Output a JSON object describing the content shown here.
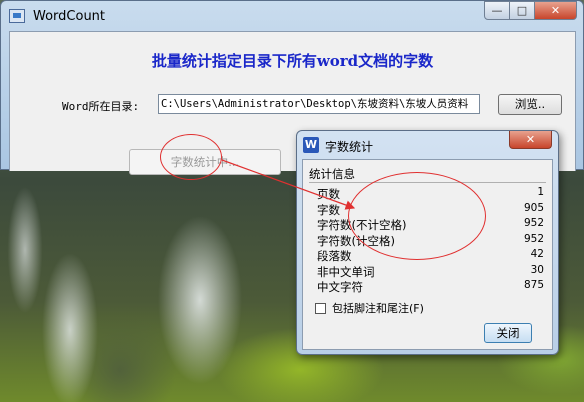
{
  "main_window": {
    "title": "WordCount",
    "buttons": {
      "minimize": "—",
      "maximize": "□",
      "close": "✕"
    },
    "headline": "批量统计指定目录下所有word文档的字数",
    "dir_label": "Word所在目录:",
    "dir_value": "C:\\Users\\Administrator\\Desktop\\东坡资料\\东坡人员资料",
    "browse_label": "浏览..",
    "count_label": "字数统计中..."
  },
  "dialog": {
    "icon_letter": "W",
    "title": "字数统计",
    "close_glyph": "✕",
    "group_label": "统计信息",
    "stats": [
      {
        "label": "页数",
        "value": "1"
      },
      {
        "label": "字数",
        "value": "905"
      },
      {
        "label": "字符数(不计空格)",
        "value": "952"
      },
      {
        "label": "字符数(计空格)",
        "value": "952"
      },
      {
        "label": "段落数",
        "value": "42"
      },
      {
        "label": "非中文单词",
        "value": "30"
      },
      {
        "label": "中文字符",
        "value": "875"
      }
    ],
    "checkbox_label": "包括脚注和尾注(F)",
    "close_label": "关闭"
  },
  "colors": {
    "headline": "#1a27c9",
    "annotation": "#e03030"
  }
}
